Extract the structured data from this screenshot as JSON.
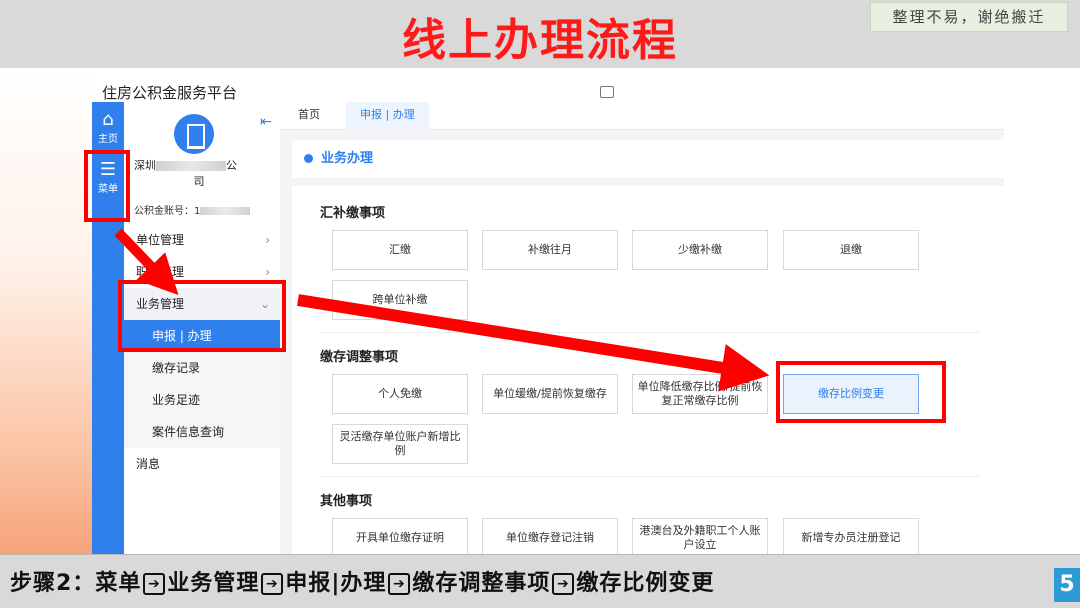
{
  "slide": {
    "title": "线上办理流程",
    "note": "整理不易，谢绝搬迁",
    "page_number": "5"
  },
  "app": {
    "brand": "住房公积金服务平台"
  },
  "rail": {
    "home_label": "主页",
    "menu_label": "菜单"
  },
  "sidebar": {
    "org_name_prefix": "深圳",
    "org_name_suffix": "公",
    "org_name_line2": "司",
    "account_label": "公积金账号：1",
    "items": [
      {
        "label": "单位管理"
      },
      {
        "label": "职工管理"
      },
      {
        "label": "业务管理"
      },
      {
        "label": "申报 | 办理"
      },
      {
        "label": "缴存记录"
      },
      {
        "label": "业务足迹"
      },
      {
        "label": "案件信息查询"
      },
      {
        "label": "消息"
      }
    ]
  },
  "tabs": [
    {
      "label": "首页"
    },
    {
      "label": "申报 | 办理"
    }
  ],
  "panel": {
    "title": "业务办理",
    "sections": [
      {
        "title": "汇补缴事项",
        "items": [
          "汇缴",
          "补缴往月",
          "少缴补缴",
          "退缴",
          "跨单位补缴"
        ]
      },
      {
        "title": "缴存调整事项",
        "items": [
          "个人免缴",
          "单位缓缴/提前恢复缴存",
          "单位降低缴存比例/提前恢复正常缴存比例",
          "缴存比例变更",
          "灵活缴存单位账户新增比例"
        ]
      },
      {
        "title": "其他事项",
        "items": [
          "开具单位缴存证明",
          "单位缴存登记注销",
          "港澳台及外籍职工个人账户设立",
          "新增专办员注册登记"
        ]
      }
    ]
  },
  "instruction": {
    "prefix": "步骤2：",
    "steps": [
      "菜单",
      "业务管理",
      "申报|办理",
      "缴存调整事项",
      "缴存比例变更"
    ],
    "arrow_glyph": "➔"
  },
  "colors": {
    "title_red": "#ff1a1a",
    "highlight_red": "#ff0000",
    "primary_blue": "#2f80ed",
    "page_badge": "#2f9bd6"
  }
}
